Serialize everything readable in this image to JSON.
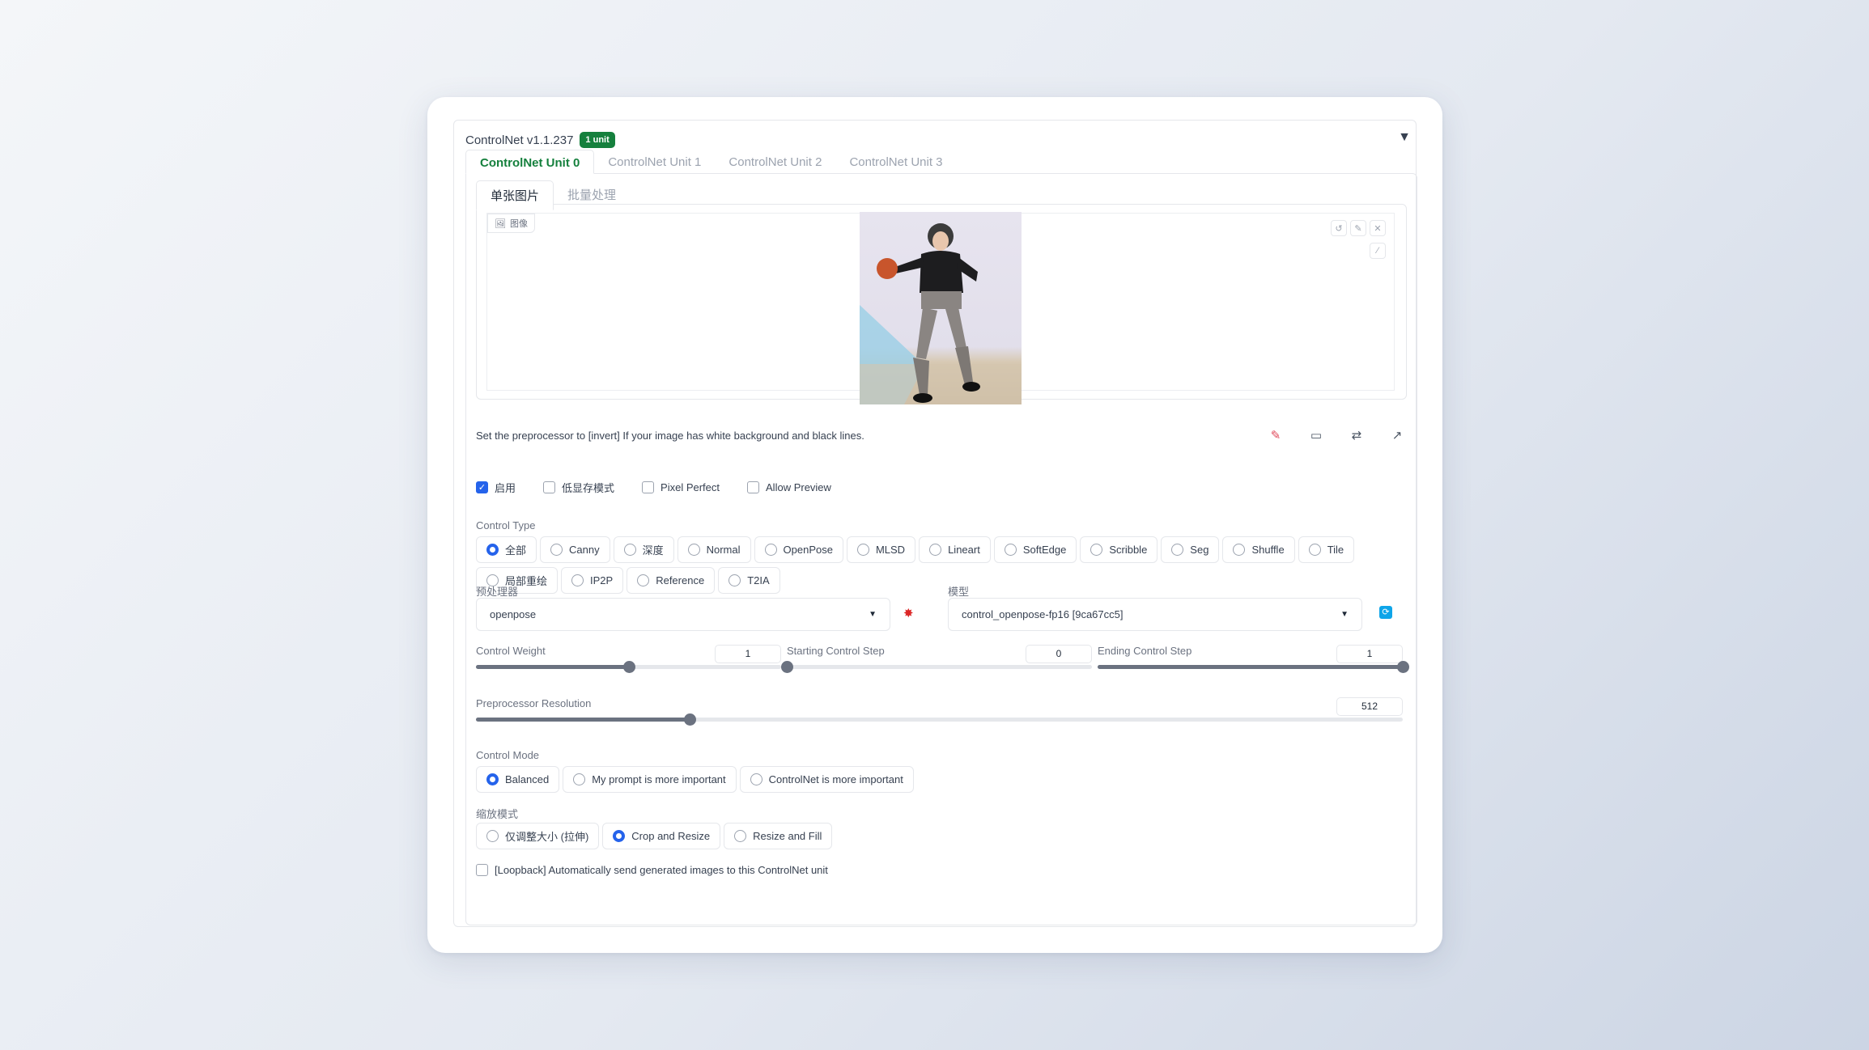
{
  "header": {
    "title": "ControlNet v1.1.237",
    "badge": "1 unit",
    "collapse": "▼"
  },
  "unit_tabs": [
    {
      "label": "ControlNet Unit 0",
      "active": true
    },
    {
      "label": "ControlNet Unit 1",
      "active": false
    },
    {
      "label": "ControlNet Unit 2",
      "active": false
    },
    {
      "label": "ControlNet Unit 3",
      "active": false
    }
  ],
  "image_tabs": [
    {
      "label": "单张图片",
      "active": true
    },
    {
      "label": "批量处理",
      "active": false
    }
  ],
  "image_panel": {
    "label": "图像"
  },
  "tip": "Set the preprocessor to [invert] If your image has white background and black lines.",
  "checkboxes": [
    {
      "label": "启用",
      "checked": true
    },
    {
      "label": "低显存模式",
      "checked": false
    },
    {
      "label": "Pixel Perfect",
      "checked": false
    },
    {
      "label": "Allow Preview",
      "checked": false
    }
  ],
  "control_type": {
    "label": "Control Type",
    "row1": [
      "全部",
      "Canny",
      "深度",
      "Normal",
      "OpenPose",
      "MLSD",
      "Lineart",
      "SoftEdge",
      "Scribble",
      "Seg",
      "Shuffle",
      "Tile"
    ],
    "row2": [
      "局部重绘",
      "IP2P",
      "Reference",
      "T2IA"
    ],
    "selected": "全部"
  },
  "preprocessor": {
    "label": "预处理器",
    "value": "openpose"
  },
  "model": {
    "label": "模型",
    "value": "control_openpose-fp16 [9ca67cc5]"
  },
  "sliders": {
    "control_weight": {
      "label": "Control Weight",
      "value": "1",
      "fraction": 0.5
    },
    "starting_step": {
      "label": "Starting Control Step",
      "value": "0",
      "fraction": 0.0
    },
    "ending_step": {
      "label": "Ending Control Step",
      "value": "1",
      "fraction": 1.0
    },
    "resolution": {
      "label": "Preprocessor Resolution",
      "value": "512",
      "fraction": 0.231
    }
  },
  "control_mode": {
    "label": "Control Mode",
    "options": [
      "Balanced",
      "My prompt is more important",
      "ControlNet is more important"
    ],
    "selected": "Balanced"
  },
  "resize_mode": {
    "label": "缩放模式",
    "options": [
      "仅调整大小 (拉伸)",
      "Crop and Resize",
      "Resize and Fill"
    ],
    "selected": "Crop and Resize"
  },
  "loopback": {
    "label": "[Loopback] Automatically send generated images to this ControlNet unit",
    "checked": false
  }
}
